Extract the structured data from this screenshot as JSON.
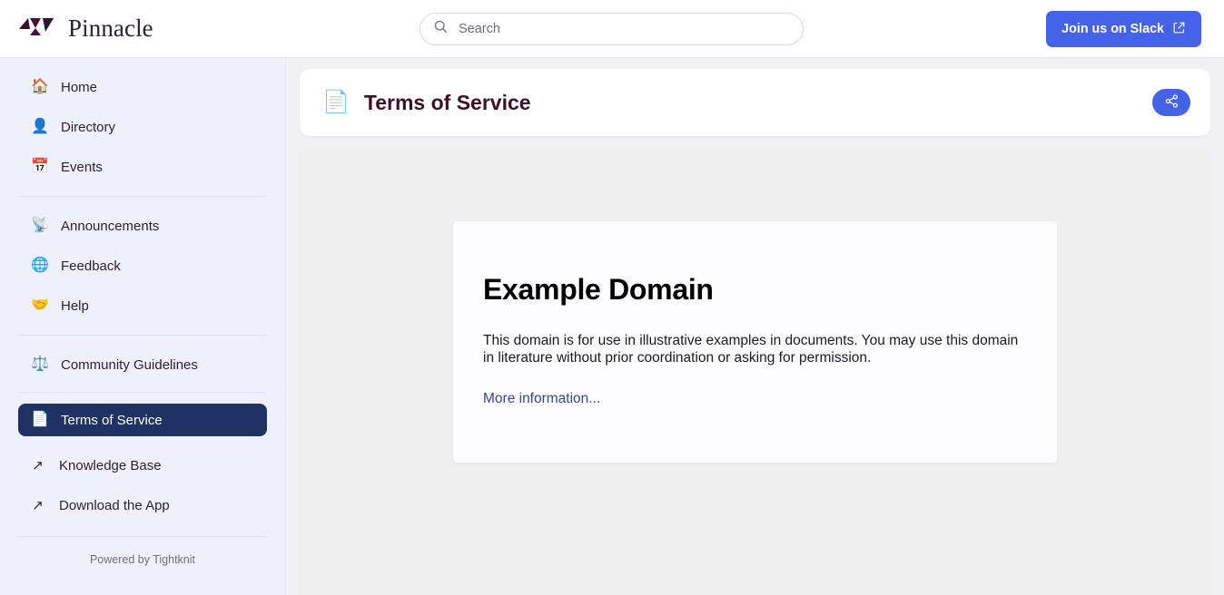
{
  "topbar": {
    "brand_name": "Pinnacle",
    "brand_mark_icon": "pinnacle-logo-mark",
    "search": {
      "icon": "search-icon",
      "placeholder": "Search",
      "value": ""
    },
    "slack_button": {
      "label": "Join us on Slack",
      "icon": "external-link-icon",
      "color": "#4463e8"
    }
  },
  "sidebar": {
    "groups": [
      {
        "items": [
          {
            "label": "Home",
            "icon": "house-icon",
            "emoji": "🏠",
            "active": false
          },
          {
            "label": "Directory",
            "icon": "person-bust-icon",
            "emoji": "👤",
            "active": false
          },
          {
            "label": "Events",
            "icon": "calendar-icon",
            "emoji": "📅",
            "active": false
          }
        ]
      },
      {
        "items": [
          {
            "label": "Announcements",
            "icon": "satellite-antenna-icon",
            "emoji": "📡",
            "active": false
          },
          {
            "label": "Feedback",
            "icon": "globe-meridians-icon",
            "emoji": "🌐",
            "active": false
          },
          {
            "label": "Help",
            "icon": "handshake-icon",
            "emoji": "🤝",
            "active": false
          }
        ]
      },
      {
        "items": [
          {
            "label": "Community Guidelines",
            "icon": "balance-scale-icon",
            "emoji": "⚖️",
            "active": false
          }
        ]
      },
      {
        "items": [
          {
            "label": "Terms of Service",
            "icon": "document-icon",
            "emoji": "📄",
            "active": true
          }
        ]
      }
    ],
    "external_links": [
      {
        "label": "Knowledge Base",
        "icon": "arrow-up-right-icon",
        "glyph": "↗"
      },
      {
        "label": "Download the App",
        "icon": "arrow-up-right-icon",
        "glyph": "↗"
      }
    ],
    "footer_text": "Powered by Tightknit",
    "active_bg_color": "#1f3263",
    "bg_color": "#eef1fc"
  },
  "main": {
    "page_header": {
      "icon": "document-icon",
      "emoji": "📄",
      "title": "Terms of Service",
      "share_button_icon": "share-network-icon",
      "share_button_color": "#4463e8"
    },
    "embed": {
      "heading": "Example Domain",
      "paragraph": "This domain is for use in illustrative examples in documents. You may use this domain in literature without prior coordination or asking for permission.",
      "link_text": "More information...",
      "link_color": "#38488f"
    }
  }
}
